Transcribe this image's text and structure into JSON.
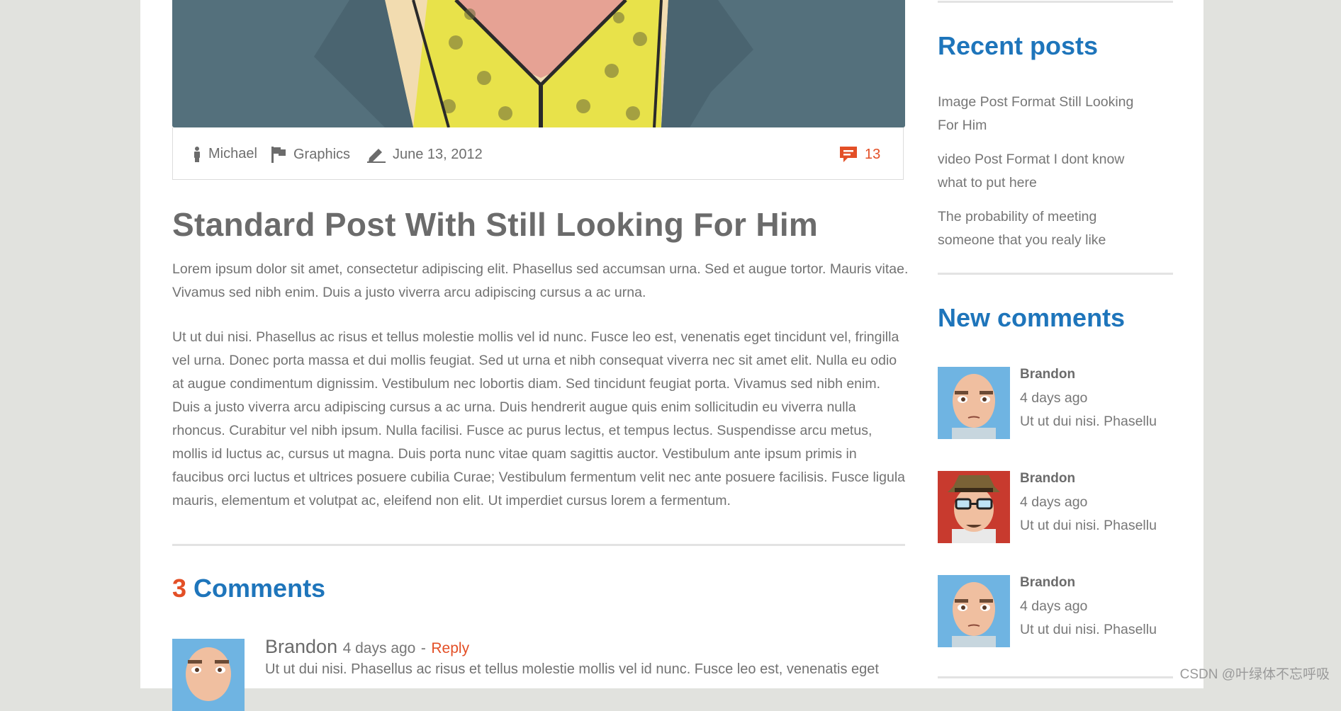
{
  "post": {
    "meta": {
      "author": "Michael",
      "category": "Graphics",
      "date": "June 13, 2012",
      "comment_count": "13"
    },
    "title": "Standard Post With Still Looking For Him",
    "paragraphs": [
      "Lorem ipsum dolor sit amet, consectetur adipiscing elit. Phasellus sed accumsan urna. Sed et augue tortor. Mauris vitae. Vivamus sed nibh enim. Duis a justo viverra arcu adipiscing cursus a ac urna.",
      "Ut ut dui nisi. Phasellus ac risus et tellus molestie mollis vel id nunc. Fusce leo est, venenatis eget tincidunt vel, fringilla vel urna. Donec porta massa et dui mollis feugiat. Sed ut urna et nibh consequat viverra nec sit amet elit. Nulla eu odio at augue condimentum dignissim. Vestibulum nec lobortis diam. Sed tincidunt feugiat porta. Vivamus sed nibh enim. Duis a justo viverra arcu adipiscing cursus a ac urna. Duis hendrerit augue quis enim sollicitudin eu viverra nulla rhoncus. Curabitur vel nibh ipsum. Nulla facilisi. Fusce ac purus lectus, et tempus lectus. Suspendisse arcu metus, mollis id luctus ac, cursus ut magna. Duis porta nunc vitae quam sagittis auctor. Vestibulum ante ipsum primis in faucibus orci luctus et ultrices posuere cubilia Curae; Vestibulum fermentum velit nec ante posuere facilisis. Fusce ligula mauris, elementum et volutpat ac, eleifend non elit. Ut imperdiet cursus lorem a fermentum."
    ]
  },
  "comments_section": {
    "count": "3",
    "title": "Comments",
    "first": {
      "author": "Brandon",
      "time": "4 days ago",
      "separator": "-",
      "reply": "Reply",
      "text": "Ut ut dui nisi. Phasellus ac risus et tellus molestie mollis vel id nunc. Fusce leo est, venenatis eget"
    }
  },
  "sidebar": {
    "recent_title": "Recent posts",
    "recent_posts": [
      "Image Post Format Still Looking For Him",
      "video Post Format I dont know what to put here",
      "The probability of meeting someone that you realy like"
    ],
    "comments_title": "New comments",
    "new_comments": [
      {
        "name": "Brandon",
        "ago": "4 days ago",
        "text": "Ut ut dui nisi. Phasellu",
        "avatar": "bald-man-avatar"
      },
      {
        "name": "Brandon",
        "ago": "4 days ago",
        "text": "Ut ut dui nisi. Phasellu",
        "avatar": "hat-glasses-man-avatar"
      },
      {
        "name": "Brandon",
        "ago": "4 days ago",
        "text": "Ut ut dui nisi. Phasellu",
        "avatar": "bald-man-avatar"
      }
    ]
  },
  "watermark": "CSDN @叶绿体不忘呼吸",
  "colors": {
    "accent_blue": "#1e75bb",
    "accent_orange": "#e34f26",
    "background": "#e1e2de"
  }
}
